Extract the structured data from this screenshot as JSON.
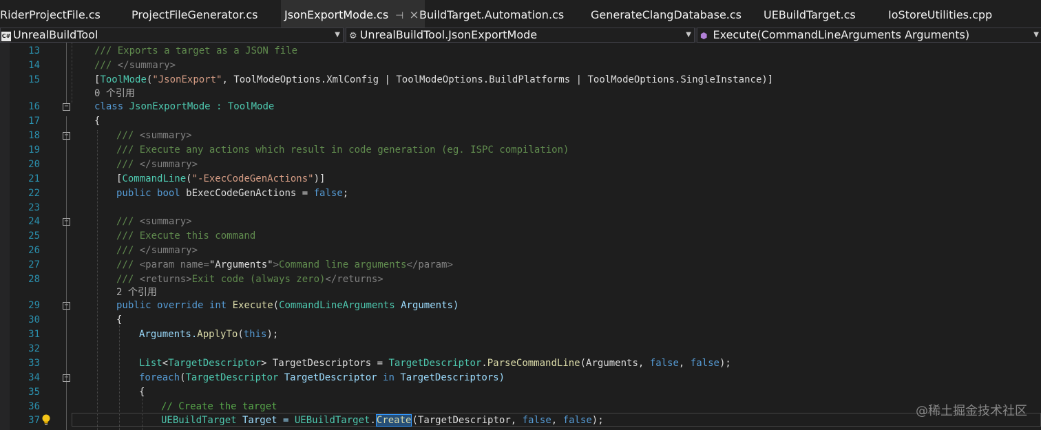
{
  "tabs": [
    {
      "label": "RiderProjectFile.cs"
    },
    {
      "label": "ProjectFileGenerator.cs"
    },
    {
      "label": "JsonExportMode.cs"
    },
    {
      "label": "BuildTarget.Automation.cs"
    },
    {
      "label": "GenerateClangDatabase.cs"
    },
    {
      "label": "UEBuildTarget.cs"
    },
    {
      "label": "IoStoreUtilities.cpp"
    }
  ],
  "nav": {
    "project": "UnrealBuildTool",
    "type": "UnrealBuildTool.JsonExportMode",
    "member": "Execute(CommandLineArguments Arguments)"
  },
  "references": {
    "class_refs": "0 个引用",
    "method_refs": "2 个引用"
  },
  "lines": {
    "n13": "13",
    "n14": "14",
    "n15": "15",
    "n16": "16",
    "n17": "17",
    "n18": "18",
    "n19": "19",
    "n20": "20",
    "n21": "21",
    "n22": "22",
    "n23": "23",
    "n24": "24",
    "n25": "25",
    "n26": "26",
    "n27": "27",
    "n28": "28",
    "n29": "29",
    "n30": "30",
    "n31": "31",
    "n32": "32",
    "n33": "33",
    "n34": "34",
    "n35": "35",
    "n36": "36",
    "n37": "37"
  },
  "code": {
    "l13": "/// Exports a target as a JSON file",
    "l14_a": "/// ",
    "l14_b": "</summary>",
    "l15_a": "[",
    "l15_b": "ToolMode",
    "l15_c": "(",
    "l15_d": "\"JsonExport\"",
    "l15_e": ", ",
    "l15_f": "ToolModeOptions",
    "l15_g": ".XmlConfig | ",
    "l15_h": "ToolModeOptions",
    "l15_i": ".BuildPlatforms | ",
    "l15_j": "ToolModeOptions",
    "l15_k": ".SingleInstance)]",
    "l16_a": "class",
    "l16_b": " JsonExportMode : ",
    "l16_c": "ToolMode",
    "l17": "{",
    "l18_a": "/// ",
    "l18_b": "<summary>",
    "l19": "/// Execute any actions which result in code generation (eg. ISPC compilation)",
    "l20_a": "/// ",
    "l20_b": "</summary>",
    "l21_a": "[",
    "l21_b": "CommandLine",
    "l21_c": "(",
    "l21_d": "\"-ExecCodeGenActions\"",
    "l21_e": ")]",
    "l22_a": "public",
    "l22_b": " ",
    "l22_c": "bool",
    "l22_d": " bExecCodeGenActions = ",
    "l22_e": "false",
    "l22_f": ";",
    "l24_a": "/// ",
    "l24_b": "<summary>",
    "l25": "/// Execute this command",
    "l26_a": "/// ",
    "l26_b": "</summary>",
    "l27_a": "/// ",
    "l27_b": "<param ",
    "l27_c": "name=",
    "l27_d": "\"Arguments\"",
    "l27_e": ">",
    "l27_f": "Command line arguments",
    "l27_g": "</param>",
    "l28_a": "/// ",
    "l28_b": "<returns>",
    "l28_c": "Exit code (always zero)",
    "l28_d": "</returns>",
    "l29_a": "public",
    "l29_b": " ",
    "l29_c": "override",
    "l29_d": " ",
    "l29_e": "int",
    "l29_f": " ",
    "l29_g": "Execute",
    "l29_h": "(",
    "l29_i": "CommandLineArguments",
    "l29_j": " Arguments)",
    "l30": "{",
    "l31_a": "Arguments.",
    "l31_b": "ApplyTo",
    "l31_c": "(",
    "l31_d": "this",
    "l31_e": ");",
    "l33_a": "List",
    "l33_b": "<",
    "l33_c": "TargetDescriptor",
    "l33_d": "> TargetDescriptors = ",
    "l33_e": "TargetDescriptor",
    "l33_f": ".",
    "l33_g": "ParseCommandLine",
    "l33_h": "(Arguments, ",
    "l33_i": "false",
    "l33_j": ", ",
    "l33_k": "false",
    "l33_l": ");",
    "l34_a": "foreach",
    "l34_b": "(",
    "l34_c": "TargetDescriptor",
    "l34_d": " TargetDescriptor ",
    "l34_e": "in",
    "l34_f": " TargetDescriptors)",
    "l35": "{",
    "l36": "// Create the target",
    "l37_a": "UEBuildTarget",
    "l37_b": " Target = ",
    "l37_c": "UEBuildTarget",
    "l37_d": ".",
    "l37_e": "Create",
    "l37_f": "(TargetDescriptor, ",
    "l37_g": "false",
    "l37_h": ", ",
    "l37_i": "false",
    "l37_j": ");"
  },
  "watermark": "@稀土掘金技术社区",
  "colors": {
    "background": "#1e1e1e",
    "keyword": "#569cd6",
    "type": "#4ec9b0",
    "comment": "#57a64a",
    "string": "#d69d85",
    "method": "#dcdcaa",
    "line_number": "#2b91af"
  }
}
